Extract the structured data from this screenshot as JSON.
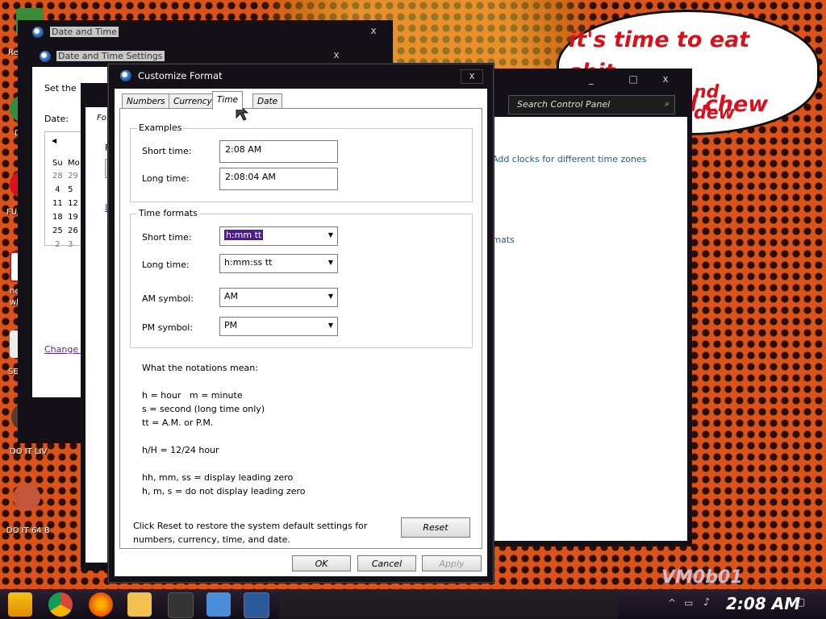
{
  "desktop": {
    "speech_line1": "it's time to eat shit",
    "speech_line2": "d chew",
    "speech_line3": "nd",
    "speech_line4": "dew",
    "watermark": "VM0b01",
    "icons": [
      {
        "label": "Re"
      },
      {
        "label": "D"
      },
      {
        "label": "FUF"
      },
      {
        "label": "ne"
      },
      {
        "label": "wh"
      },
      {
        "label": "SEX"
      },
      {
        "label": "DO IT LIV"
      },
      {
        "label": "DO IT 64 B"
      }
    ]
  },
  "windows": {
    "date_time": {
      "title": "Date and Time"
    },
    "date_time_settings": {
      "title": "Date and Time Settings",
      "set_the": "Set the",
      "date_label": "Date:",
      "cal_nav": "◀",
      "cal_days": "Su  Mo",
      "cal_rows": [
        "28  29",
        " 4   5",
        "11  12",
        "18  19",
        "25  26",
        " 2   3"
      ],
      "change_link": "Change c"
    },
    "control_panel": {
      "search_placeholder": "Search Control Panel",
      "link_clocks": "Add clocks for different time zones",
      "link_formats": "rmats"
    },
    "region": {
      "tab_fo": "Fo",
      "label_f": "F",
      "link_l": "L"
    }
  },
  "dialog": {
    "title": "Customize Format",
    "close": "x",
    "tabs": [
      "Numbers",
      "Currency",
      "Time",
      "Date"
    ],
    "examples": {
      "title": "Examples",
      "short_label": "Short time:",
      "short_value": "2:08 AM",
      "long_label": "Long time:",
      "long_value": "2:08:04 AM"
    },
    "formats": {
      "title": "Time formats",
      "short_label": "Short time:",
      "short_value": "h:mm tt",
      "long_label": "Long time:",
      "long_value": "h:mm:ss tt",
      "am_label": "AM symbol:",
      "am_value": "AM",
      "pm_label": "PM symbol:",
      "pm_value": "PM"
    },
    "notes": {
      "heading": "What the notations mean:",
      "line1": "h = hour   m = minute",
      "line2": "s = second (long time only)",
      "line3": "tt = A.M. or P.M.",
      "line4": "h/H = 12/24 hour",
      "line5": "hh, mm, ss = display leading zero",
      "line6": "h, m, s = do not display leading zero"
    },
    "reset_text_1": "Click Reset to restore the system default settings for",
    "reset_text_2": "numbers, currency, time, and date.",
    "reset_button": "Reset",
    "ok_button": "OK",
    "cancel_button": "Cancel",
    "apply_button": "Apply"
  },
  "taskbar": {
    "clock": "2:08 AM",
    "apps": [
      "start",
      "chrome",
      "firefox",
      "file-explorer",
      "media",
      "control-panel",
      "date-time"
    ]
  }
}
